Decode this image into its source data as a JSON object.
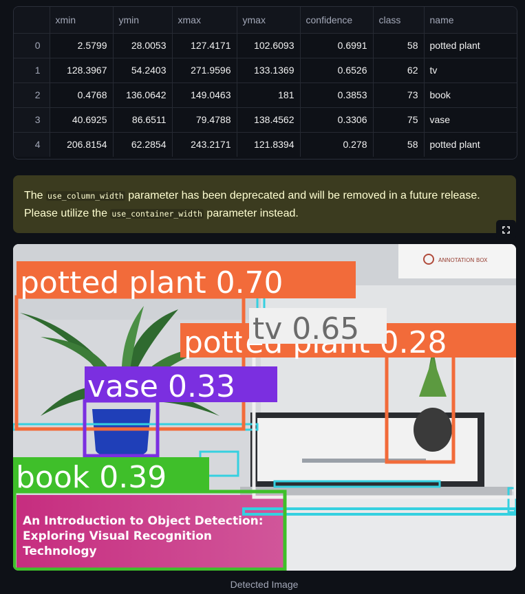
{
  "dataframe": {
    "columns": [
      "",
      "xmin",
      "ymin",
      "xmax",
      "ymax",
      "confidence",
      "class",
      "name"
    ],
    "rows": [
      {
        "index": "0",
        "xmin": "2.5799",
        "ymin": "28.0053",
        "xmax": "127.4171",
        "ymax": "102.6093",
        "confidence": "0.6991",
        "class": "58",
        "name": "potted plant"
      },
      {
        "index": "1",
        "xmin": "128.3967",
        "ymin": "54.2403",
        "xmax": "271.9596",
        "ymax": "133.1369",
        "confidence": "0.6526",
        "class": "62",
        "name": "tv"
      },
      {
        "index": "2",
        "xmin": "0.4768",
        "ymin": "136.0642",
        "xmax": "149.0463",
        "ymax": "181",
        "confidence": "0.3853",
        "class": "73",
        "name": "book"
      },
      {
        "index": "3",
        "xmin": "40.6925",
        "ymin": "86.6511",
        "xmax": "79.4788",
        "ymax": "138.4562",
        "confidence": "0.3306",
        "class": "75",
        "name": "vase"
      },
      {
        "index": "4",
        "xmin": "206.8154",
        "ymin": "62.2854",
        "xmax": "243.2171",
        "ymax": "121.8394",
        "confidence": "0.278",
        "class": "58",
        "name": "potted plant"
      }
    ]
  },
  "warning": {
    "text_1": "The ",
    "code_1": "use_column_width",
    "text_2": " parameter has been deprecated and will be removed in a future release. Please utilize the ",
    "code_2": "use_container_width",
    "text_3": " parameter instead."
  },
  "fullscreen_icon": "expand-icon",
  "image": {
    "labels": {
      "plant1": "potted plant 0.70",
      "tv": "tv 0.65",
      "plant2": "potted plant 0.28",
      "vase": "vase 0.33",
      "book": "book 0.39"
    },
    "watermark": "ANNOTATION BOX",
    "banner_line1": "An Introduction to Object Detection:",
    "banner_line2": "Exploring Visual Recognition",
    "banner_line3": "Technology",
    "colors": {
      "plant": "#f26b3a",
      "tv": "#f0f0f0",
      "vase": "#7b2fe0",
      "book": "#3fbf2a",
      "other": "#35d0e0"
    }
  },
  "caption": "Detected Image"
}
